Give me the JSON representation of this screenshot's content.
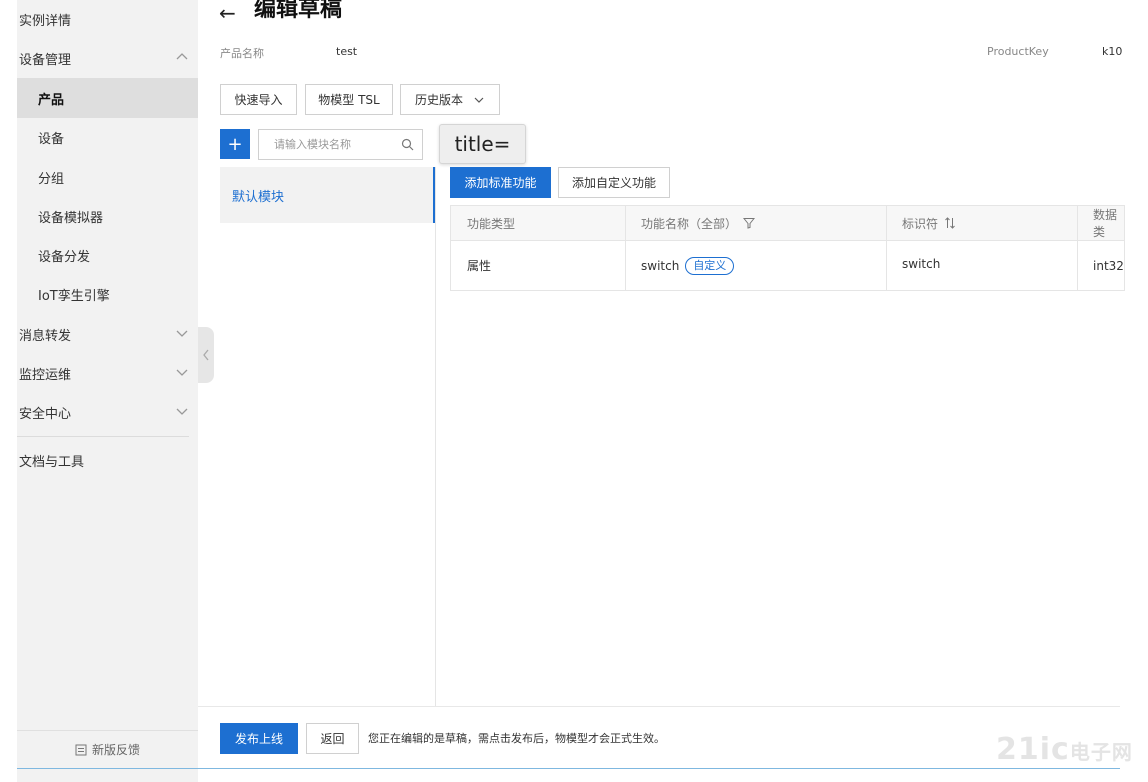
{
  "sidebar": {
    "top_item": "实例详情",
    "group_device_mgmt": "设备管理",
    "items": [
      {
        "label": "产品"
      },
      {
        "label": "设备"
      },
      {
        "label": "分组"
      },
      {
        "label": "设备模拟器"
      },
      {
        "label": "设备分发"
      },
      {
        "label": "IoT孪生引擎"
      }
    ],
    "group_msg_forward": "消息转发",
    "group_monitor_ops": "监控运维",
    "group_security": "安全中心",
    "docs_tools": "文档与工具",
    "feedback": "新版反馈"
  },
  "header": {
    "back_arrow": "←",
    "title": "编辑草稿",
    "product_name_label": "产品名称",
    "product_name_value": "test",
    "product_key_label": "ProductKey",
    "product_key_value": "k10"
  },
  "toolbar": {
    "quick_import": "快速导入",
    "tsl": "物模型 TSL",
    "history": "历史版本"
  },
  "modules": {
    "add": "+",
    "search_placeholder": "请输入模块名称",
    "default_module": "默认模块"
  },
  "tooltip": "title=",
  "actions": {
    "add_standard": "添加标准功能",
    "add_custom": "添加自定义功能"
  },
  "table": {
    "headers": {
      "type": "功能类型",
      "name": "功能名称（全部）",
      "identifier": "标识符",
      "data_type": "数据类"
    },
    "rows": [
      {
        "type": "属性",
        "name": "switch",
        "tag": "自定义",
        "identifier": "switch",
        "data_type": "int32"
      }
    ]
  },
  "footer": {
    "publish": "发布上线",
    "back": "返回",
    "note": "您正在编辑的是草稿，需点击发布后，物模型才会正式生效。"
  },
  "watermark": {
    "main": "21ic",
    "sub": "电子网"
  },
  "colors": {
    "primary": "#1d6fd1",
    "sidebar_bg": "#f2f2f2",
    "active_bg": "#dedede"
  }
}
